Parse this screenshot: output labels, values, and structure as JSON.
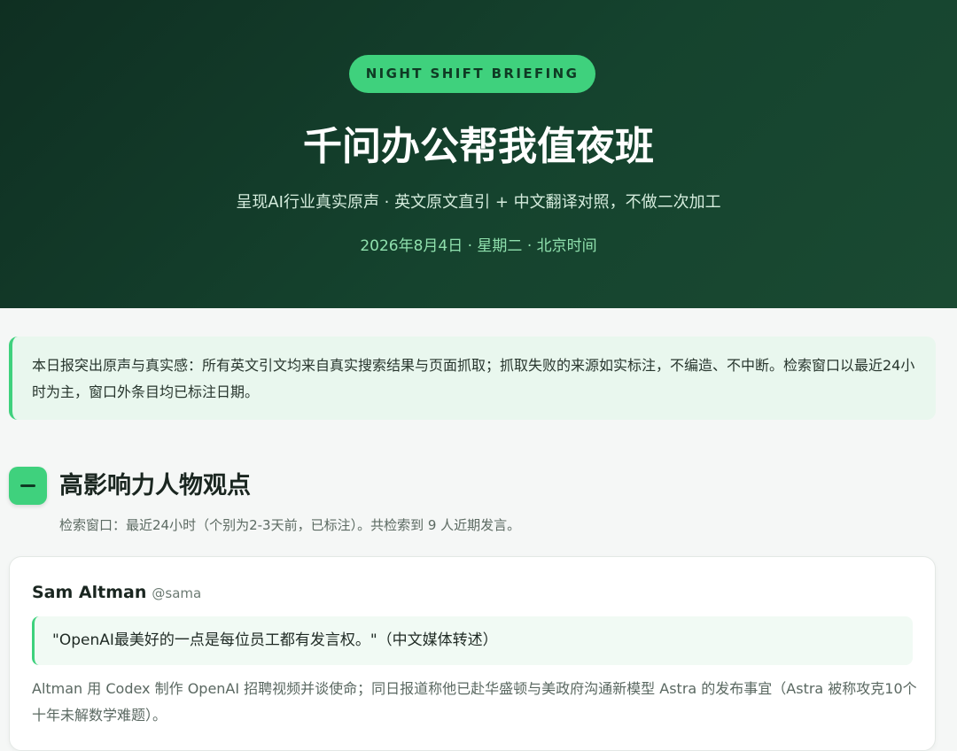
{
  "hero": {
    "badge": "NIGHT SHIFT BRIEFING",
    "title": "千问办公帮我值夜班",
    "subtitle": "呈现AI行业真实原声 · 英文原文直引 + 中文翻译对照，不做二次加工",
    "date": "2026年8月4日 · 星期二 · 北京时间"
  },
  "notice": {
    "text": "本日报突出原声与真实感：所有英文引文均来自真实搜索结果与页面抓取；抓取失败的来源如实标注，不编造、不中断。检索窗口以最近24小时为主，窗口外条目均已标注日期。"
  },
  "section": {
    "icon": "minus-icon",
    "title": "高影响力人物观点",
    "meta": "检索窗口：最近24小时（个别为2-3天前，已标注）。共检索到 9 人近期发言。"
  },
  "cards": [
    {
      "name": "Sam Altman",
      "handle": "@sama",
      "quote": "\"OpenAI最美好的一点是每位员工都有发言权。\"（中文媒体转述）",
      "description": "Altman 用 Codex 制作 OpenAI 招聘视频并谈使命；同日报道称他已赴华盛顿与美政府沟通新模型 Astra 的发布事宜（Astra 被称攻克10个十年未解数学难题）。"
    }
  ],
  "colors": {
    "accent": "#3fd17d",
    "hero_bg": "#15432e",
    "page_bg": "#f5f7f6"
  }
}
